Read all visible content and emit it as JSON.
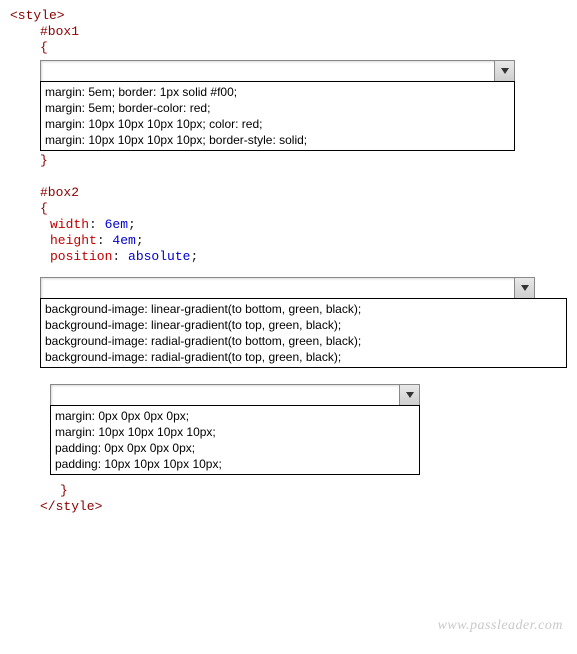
{
  "code": {
    "style_open": "<style>",
    "style_close": "</style>",
    "box1_selector": "#box1",
    "box2_selector": "#box2",
    "brace_open": "{",
    "brace_close": "}",
    "box2_props": {
      "p1_name": "width",
      "p1_val": "6em",
      "p2_name": "height",
      "p2_val": "4em",
      "p3_name": "position",
      "p3_val": "absolute"
    }
  },
  "select1": {
    "options": [
      "margin: 5em; border: 1px solid #f00;",
      "margin: 5em; border-color: red;",
      "margin: 10px 10px 10px 10px; color: red;",
      "margin: 10px 10px 10px 10px; border-style: solid;"
    ]
  },
  "select2": {
    "options": [
      "background-image: linear-gradient(to bottom, green, black);",
      "background-image: linear-gradient(to top, green, black);",
      "background-image: radial-gradient(to bottom, green, black);",
      "background-image: radial-gradient(to top, green, black);"
    ]
  },
  "select3": {
    "options": [
      "margin: 0px 0px 0px 0px;",
      "margin: 10px 10px 10px 10px;",
      "padding: 0px 0px 0px 0px;",
      "padding: 10px 10px 10px 10px;"
    ]
  },
  "watermark": "www.passleader.com"
}
